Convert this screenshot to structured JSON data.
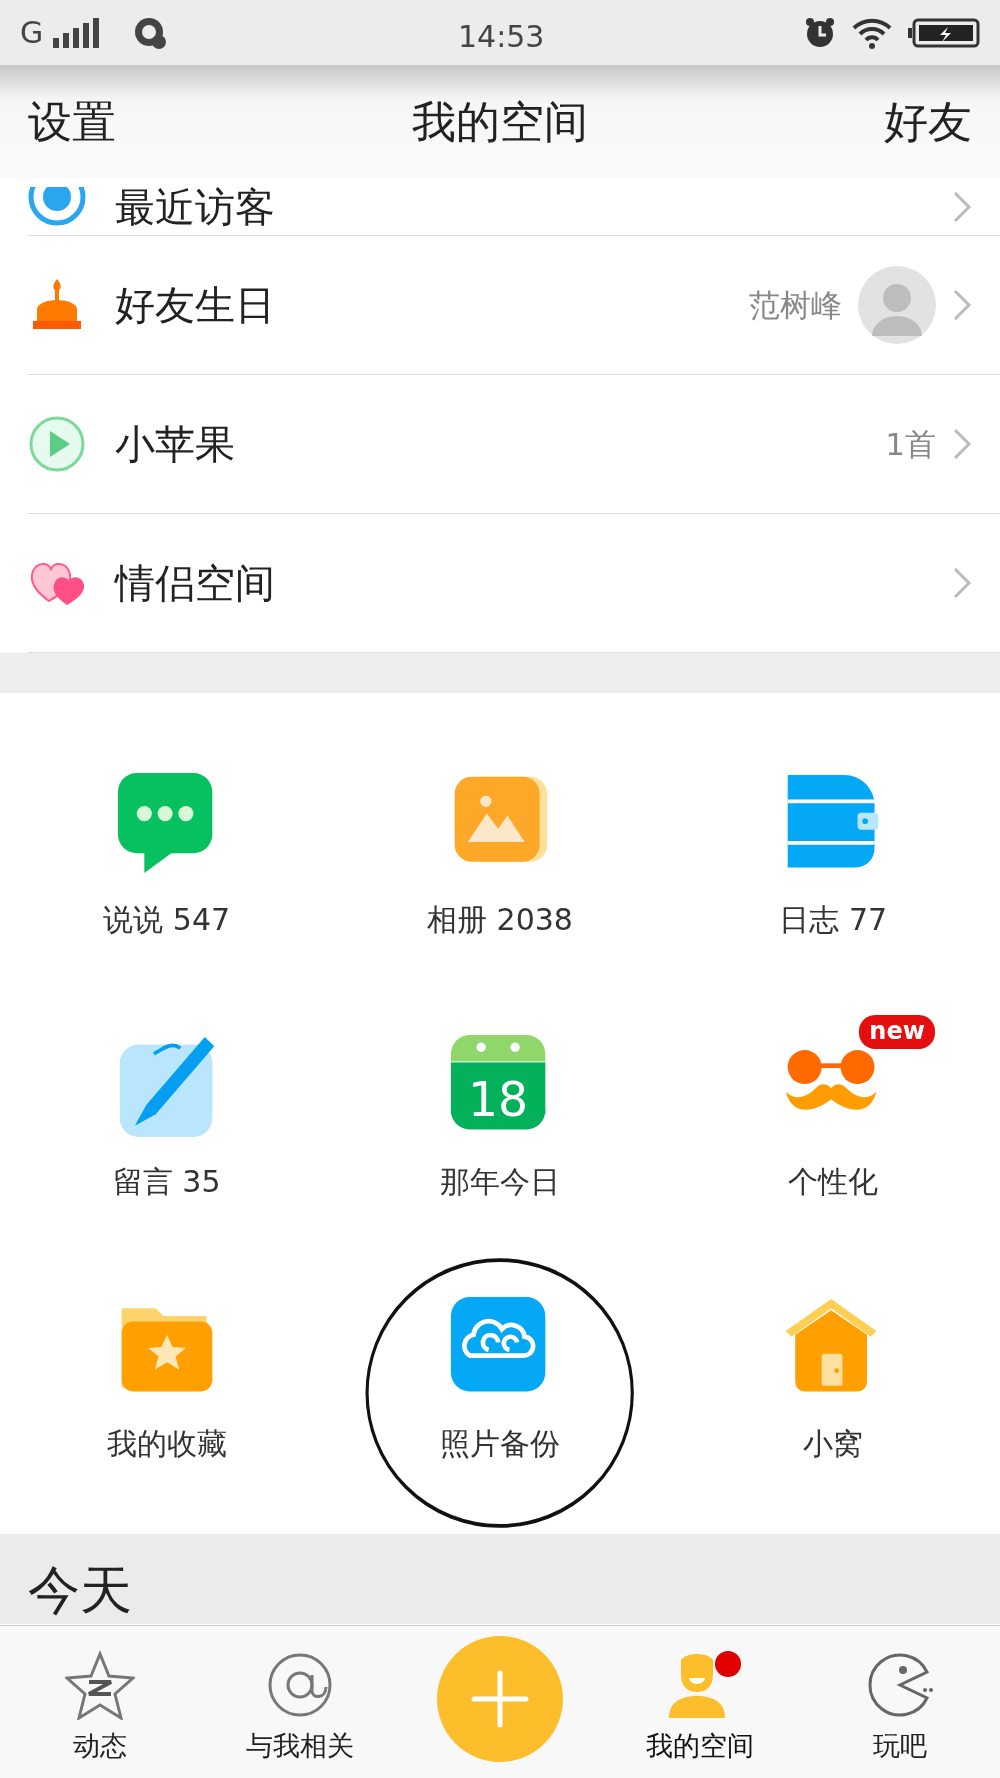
{
  "status_bar": {
    "carrier": "G",
    "time": "14:53"
  },
  "header": {
    "left": "设置",
    "title": "我的空间",
    "right": "好友"
  },
  "list_rows": [
    {
      "kind": "visitors",
      "label": "最近访客"
    },
    {
      "kind": "birthday",
      "label": "好友生日",
      "detail": "范树峰",
      "avatar": true
    },
    {
      "kind": "music",
      "label": "小苹果",
      "detail": "1首"
    },
    {
      "kind": "couple",
      "label": "情侣空间"
    }
  ],
  "grid": [
    {
      "kind": "chat",
      "label": "说说 547"
    },
    {
      "kind": "album",
      "label": "相册 2038"
    },
    {
      "kind": "diary",
      "label": "日志 77"
    },
    {
      "kind": "pen",
      "label": "留言 35"
    },
    {
      "kind": "calendar",
      "label": "那年今日",
      "icon_text": "18"
    },
    {
      "kind": "mustache",
      "label": "个性化",
      "badge": "new"
    },
    {
      "kind": "folder",
      "label": "我的收藏"
    },
    {
      "kind": "cloud",
      "label": "照片备份",
      "circled": true
    },
    {
      "kind": "house",
      "label": "小窝"
    }
  ],
  "section_title": "今天",
  "nav": [
    {
      "kind": "star",
      "label": "动态",
      "selected": false
    },
    {
      "kind": "at",
      "label": "与我相关",
      "selected": false
    },
    {
      "kind": "plus"
    },
    {
      "kind": "person",
      "label": "我的空间",
      "selected": true,
      "dot": true
    },
    {
      "kind": "pacman",
      "label": "玩吧",
      "selected": false
    }
  ]
}
